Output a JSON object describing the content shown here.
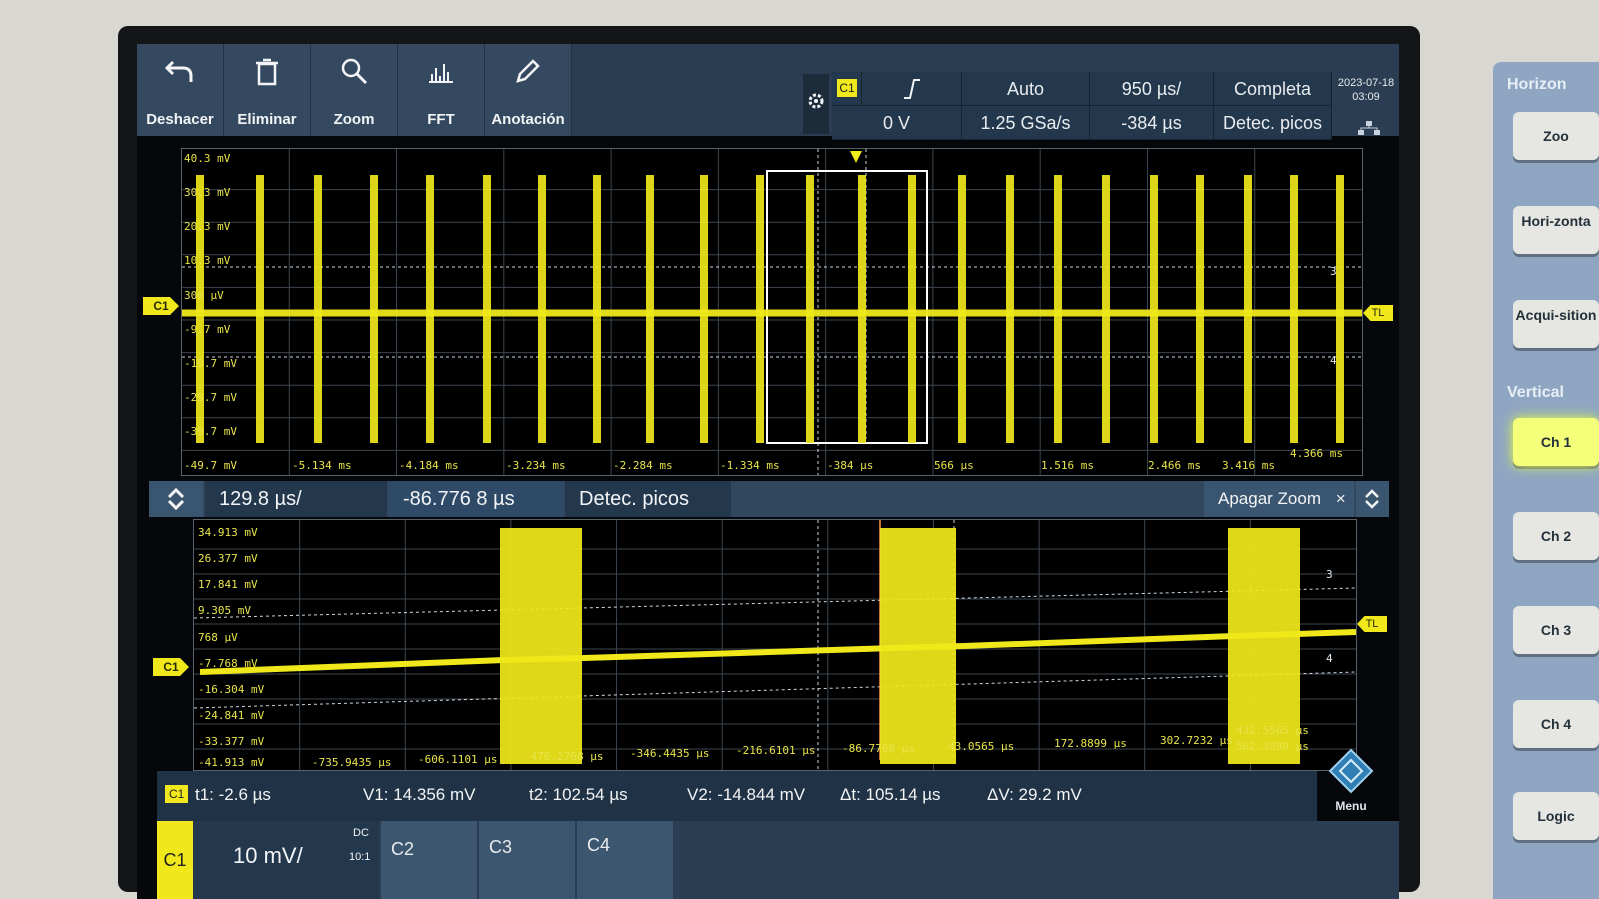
{
  "toolbar": {
    "undo_label": "Deshacer",
    "delete_label": "Eliminar",
    "zoom_label": "Zoom",
    "fft_label": "FFT",
    "annotation_label": "Anotación"
  },
  "trigger": {
    "channel": "C1",
    "level": "0 V",
    "mode": "Auto",
    "sample_rate": "1.25 GSa/s",
    "timebase": "950 µs/",
    "position": "-384 µs",
    "acquisition": "Completa",
    "detection": "Detec. picos",
    "date": "2023-07-18",
    "time": "03:09"
  },
  "main_plot": {
    "y_labels": [
      "40.3 mV",
      "30.3 mV",
      "20.3 mV",
      "10.3 mV",
      "300 µV",
      "-9.7 mV",
      "-19.7 mV",
      "-29.7 mV",
      "-39.7 mV",
      "-49.7 mV"
    ],
    "x_labels": [
      "-5.134 ms",
      "-4.184 ms",
      "-3.234 ms",
      "-2.284 ms",
      "-1.334 ms",
      "-384 µs",
      "566 µs",
      "1.516 ms",
      "2.466 ms",
      "3.416 ms",
      "4.366 ms"
    ],
    "channel_marker": "C1",
    "trigger_marker": "TL",
    "cursor3": "3",
    "cursor4": "4"
  },
  "zoom_bar": {
    "scale": "129.8 µs/",
    "position": "-86.776 8 µs",
    "mode": "Detec. picos",
    "off_label": "Apagar Zoom",
    "close": "×"
  },
  "zoom_plot": {
    "y_labels": [
      "34.913 mV",
      "26.377 mV",
      "17.841 mV",
      "9.305 mV",
      "768 µV",
      "-7.768 mV",
      "-16.304 mV",
      "-24.841 mV",
      "-33.377 mV",
      "-41.913 mV"
    ],
    "x_labels": [
      "-735.9435 µs",
      "-606.1101 µs",
      "-476.2768 µs",
      "-346.4435 µs",
      "-216.6101 µs",
      "-86.7768 µs",
      "43.0565 µs",
      "172.8899 µs",
      "302.7232 µs",
      "432.5565 µs",
      "562.3899 µs"
    ],
    "channel_marker": "C1",
    "trigger_marker": "TL",
    "cursor3": "3",
    "cursor4": "4"
  },
  "measurements": {
    "channel": "C1",
    "t1": "t1: -2.6 µs",
    "v1": "V1: 14.356 mV",
    "t2": "t2: 102.54 µs",
    "v2": "V2: -14.844 mV",
    "dt": "Δt: 105.14 µs",
    "dv": "ΔV: 29.2 mV",
    "menu": "Menu"
  },
  "channels": {
    "c1": "C1",
    "c1_scale": "10 mV/",
    "c1_coupling": "DC",
    "c1_probe": "10:1",
    "c2": "C2",
    "c3": "C3",
    "c4": "C4"
  },
  "side_panel": {
    "horizontal_title": "Horizon",
    "zoom_btn": "Zoo",
    "horiz_btn": "Hori-zonta",
    "acq_btn": "Acqui-sition",
    "vertical_title": "Vertical",
    "ch1": "Ch 1",
    "ch2": "Ch 2",
    "ch3": "Ch 3",
    "ch4": "Ch 4",
    "logic": "Logic"
  },
  "colors": {
    "trace": "#f0e81a",
    "screen_bg": "#000000",
    "panel": "#24384d"
  },
  "icons": [
    "undo-icon",
    "trash-icon",
    "magnifier-icon",
    "fft-icon",
    "pencil-icon",
    "gear-icon",
    "trigger-edge-icon",
    "network-icon",
    "menu-diamond-icon"
  ]
}
